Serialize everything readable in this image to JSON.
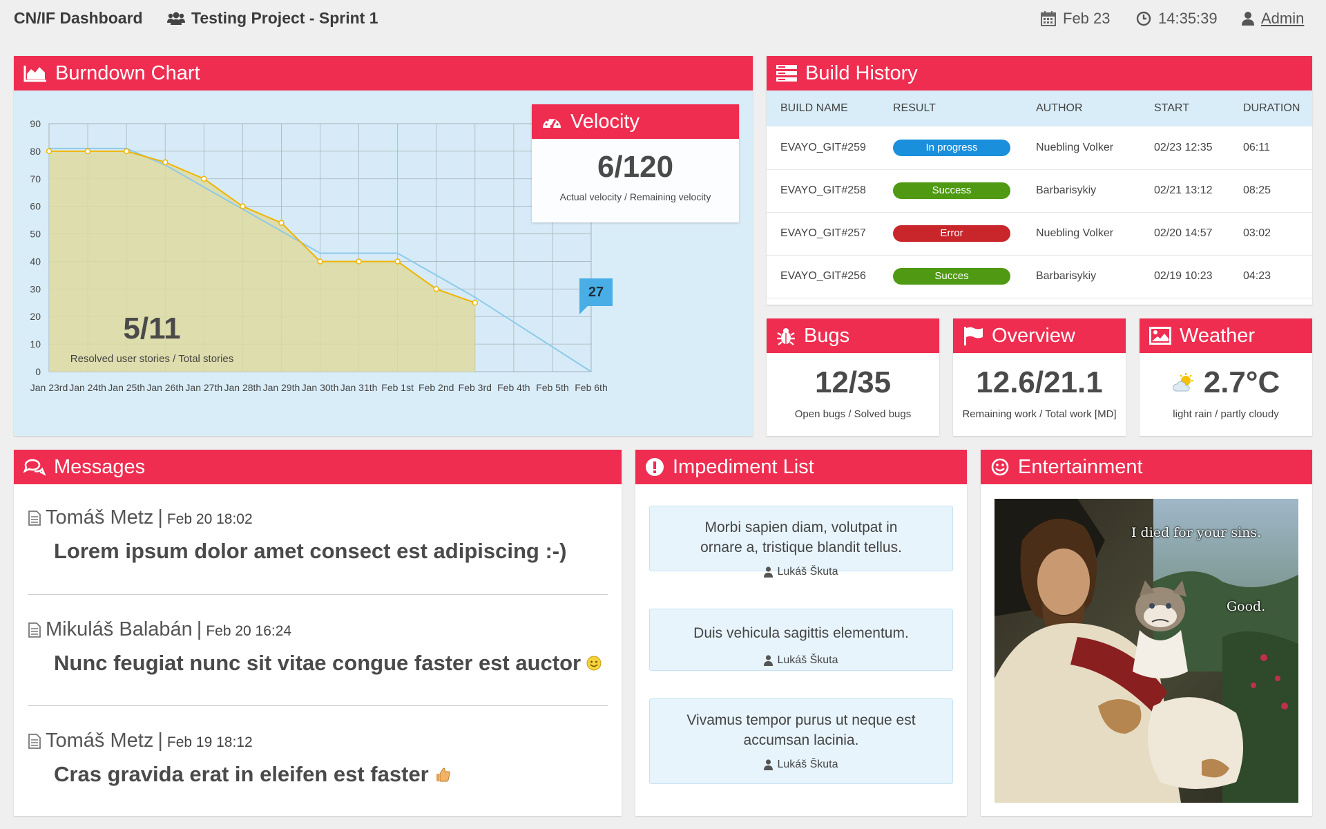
{
  "topbar": {
    "brand": "CN/IF Dashboard",
    "project": "Testing Project - Sprint 1",
    "date": "Feb 23",
    "time": "14:35:39",
    "user": "Admin"
  },
  "burndown": {
    "title": "Burndown Chart",
    "stories_value": "5/11",
    "stories_label": "Resolved user stories / Total stories",
    "current_flag": "27",
    "velocity": {
      "title": "Velocity",
      "value": "6/120",
      "label": "Actual velocity / Remaining velocity"
    }
  },
  "chart_data": {
    "type": "line",
    "title": "",
    "x": [
      "Jan 23rd",
      "Jan 24th",
      "Jan 25th",
      "Jan 26th",
      "Jan 27th",
      "Jan 28th",
      "Jan 29th",
      "Jan 30th",
      "Jan 31th",
      "Feb 1st",
      "Feb 2nd",
      "Feb 3rd",
      "Feb 4th",
      "Feb 5th",
      "Feb 6th"
    ],
    "ylim": [
      0,
      90
    ],
    "yticks": [
      0,
      10,
      20,
      30,
      40,
      50,
      60,
      70,
      80,
      90
    ],
    "grid": true,
    "series": [
      {
        "values": [
          80,
          80,
          80,
          76,
          70,
          60,
          54,
          40,
          40,
          40,
          30,
          25,
          null,
          null,
          null
        ],
        "color": "#f0b400",
        "fill": "#dedba0"
      },
      {
        "values": [
          81,
          81,
          81,
          75,
          67,
          59,
          51,
          43,
          43,
          43,
          35,
          27,
          18,
          9,
          0
        ],
        "color": "#8ecaea"
      }
    ]
  },
  "builds": {
    "title": "Build History",
    "columns": [
      "BUILD NAME",
      "RESULT",
      "AUTHOR",
      "START",
      "DURATION"
    ],
    "rows": [
      {
        "name": "EVAYO_GIT#259",
        "result": "In progress",
        "color": "#1a8fdc",
        "author": "Nuebling Volker",
        "start": "02/23 12:35",
        "duration": "06:11"
      },
      {
        "name": "EVAYO_GIT#258",
        "result": "Success",
        "color": "#4f9a12",
        "author": "Barbarisykiy",
        "start": "02/21 13:12",
        "duration": "08:25"
      },
      {
        "name": "EVAYO_GIT#257",
        "result": "Error",
        "color": "#c8262b",
        "author": "Nuebling Volker",
        "start": "02/20 14:57",
        "duration": "03:02"
      },
      {
        "name": "EVAYO_GIT#256",
        "result": "Succes",
        "color": "#4f9a12",
        "author": "Barbarisykiy",
        "start": "02/19 10:23",
        "duration": "04:23"
      }
    ]
  },
  "bugs": {
    "title": "Bugs",
    "value": "12/35",
    "label": "Open bugs / Solved bugs"
  },
  "overview": {
    "title": "Overview",
    "value": "12.6/21.1",
    "label": "Remaining work / Total work [MD]"
  },
  "weather": {
    "title": "Weather",
    "value": "2.7°C",
    "label": "light rain / partly cloudy"
  },
  "messages": {
    "title": "Messages",
    "items": [
      {
        "author": "Tomáš Metz",
        "date": "Feb 20 18:02",
        "text": "Lorem ipsum dolor amet consect est adipiscing :-)",
        "emoji": ""
      },
      {
        "author": "Mikuláš Balabán",
        "date": "Feb 20 16:24",
        "text": "Nunc feugiat nunc sit vitae congue faster est auctor",
        "emoji": "smile"
      },
      {
        "author": "Tomáš Metz",
        "date": "Feb 19 18:12",
        "text": "Cras gravida erat in eleifen est faster",
        "emoji": "thumbs-up"
      }
    ]
  },
  "impediments": {
    "title": "Impediment List",
    "items": [
      {
        "text": "Morbi sapien diam, volutpat in ornare a, tristique blandit tellus.",
        "author": "Lukáš Škuta"
      },
      {
        "text": "Duis vehicula sagittis elementum.",
        "author": "Lukáš Škuta"
      },
      {
        "text": "Vivamus tempor purus ut neque est accumsan lacinia.",
        "author": "Lukáš Škuta"
      }
    ]
  },
  "entertainment": {
    "title": "Entertainment",
    "caption_top": "I died for your sins.",
    "caption_bottom": "Good."
  },
  "colors": {
    "accent": "#ef2d50",
    "panel_tint": "#d9edf8"
  }
}
